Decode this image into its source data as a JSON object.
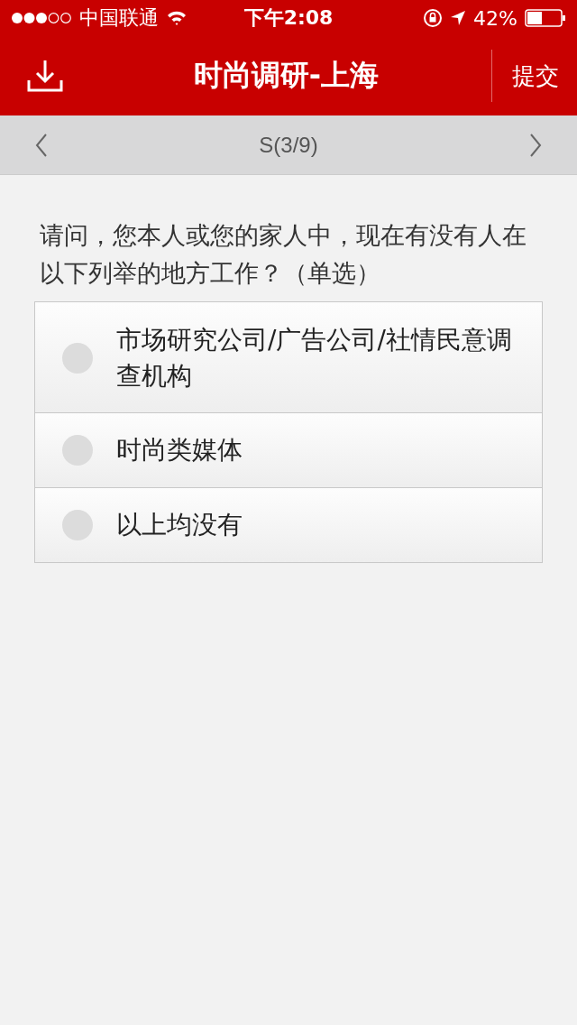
{
  "status_bar": {
    "carrier": "中国联通",
    "time": "下午2:08",
    "battery": "42%"
  },
  "nav_bar": {
    "title": "时尚调研-上海",
    "submit": "提交"
  },
  "pager": {
    "label": "S(3/9)"
  },
  "question": {
    "text": "请问，您本人或您的家人中，现在有没有人在以下列举的地方工作？（单选）",
    "options": [
      {
        "label": "市场研究公司/广告公司/社情民意调查机构",
        "selected": false
      },
      {
        "label": "时尚类媒体",
        "selected": false
      },
      {
        "label": "以上均没有",
        "selected": false
      }
    ]
  }
}
